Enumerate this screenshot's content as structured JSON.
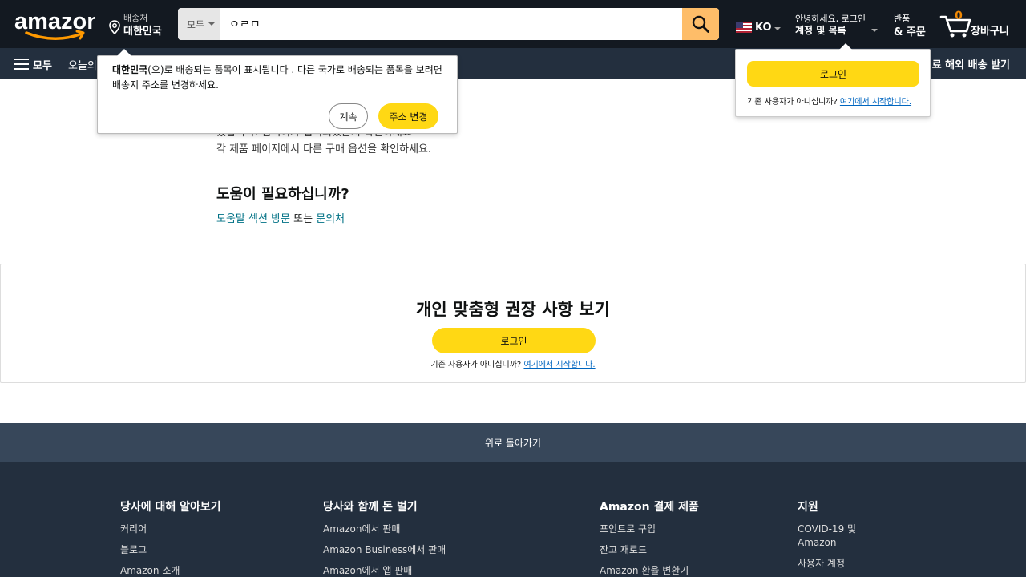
{
  "header": {
    "logo_text": "amazon",
    "deliver_label": "배송처",
    "deliver_country": "대한민국",
    "search": {
      "department": "모두",
      "query": "ㅇㄹㅁ"
    },
    "language": "KO",
    "account_greeting": "안녕하세요, 로그인",
    "account_lists": "계정 및 목록",
    "returns_label": "반품",
    "orders_label": "& 주문",
    "cart_count": "0",
    "cart_label": "장바구니"
  },
  "subnav": {
    "all_label": "모두",
    "today_deals": "오늘의",
    "promo": "료 해외 배송 받기"
  },
  "location_popover": {
    "country": "대한민국",
    "message": "(으)로 배송되는 품목이 표시됩니다 . 다른 국가로 배송되는 품목을 보려면 배송지 주소를 변경하세요.",
    "continue_label": "계속",
    "change_label": "주소 변경"
  },
  "signin_popover": {
    "button_label": "로그인",
    "new_customer": "기존 사용자가 아니십니까?",
    "start_link": "여기에서 시작합니다."
  },
  "content": {
    "partial_text": "있습니다. 검색어가 입력되었는지 확인하세요",
    "other_options": "각 제품 페이지에서 다른 구매 옵션을 확인하세요.",
    "help_title": "도움이 필요하십니까?",
    "help_link": "도움말 섹션 방문",
    "help_or": " 또는 ",
    "contact_link": "문의처"
  },
  "recommendations": {
    "title": "개인 맞춤형 권장 사항 보기",
    "signin_label": "로그인",
    "new_customer": "기존 사용자가 아니십니까?",
    "start_link": "여기에서 시작합니다."
  },
  "footer": {
    "back_to_top": "위로 돌아가기",
    "columns": [
      {
        "heading": "당사에 대해 알아보기",
        "items": [
          "커리어",
          "블로그",
          "Amazon 소개"
        ]
      },
      {
        "heading": "당사와 함께 돈 벌기",
        "items": [
          "Amazon에서 판매",
          "Amazon Business에서 판매",
          "Amazon에서 앱 판매"
        ]
      },
      {
        "heading": "Amazon 결제 제품",
        "items": [
          "포인트로 구입",
          "잔고 재로드",
          "Amazon 환율 변환기"
        ]
      },
      {
        "heading": "지원",
        "items": [
          "COVID-19 및 Amazon",
          "사용자 계정"
        ]
      }
    ]
  },
  "colors": {
    "header_bg": "#131921",
    "subnav_bg": "#232f3e",
    "button_yellow": "#ffd814",
    "search_button": "#febd69",
    "link": "#007185",
    "back_to_top_bg": "#37475a"
  }
}
